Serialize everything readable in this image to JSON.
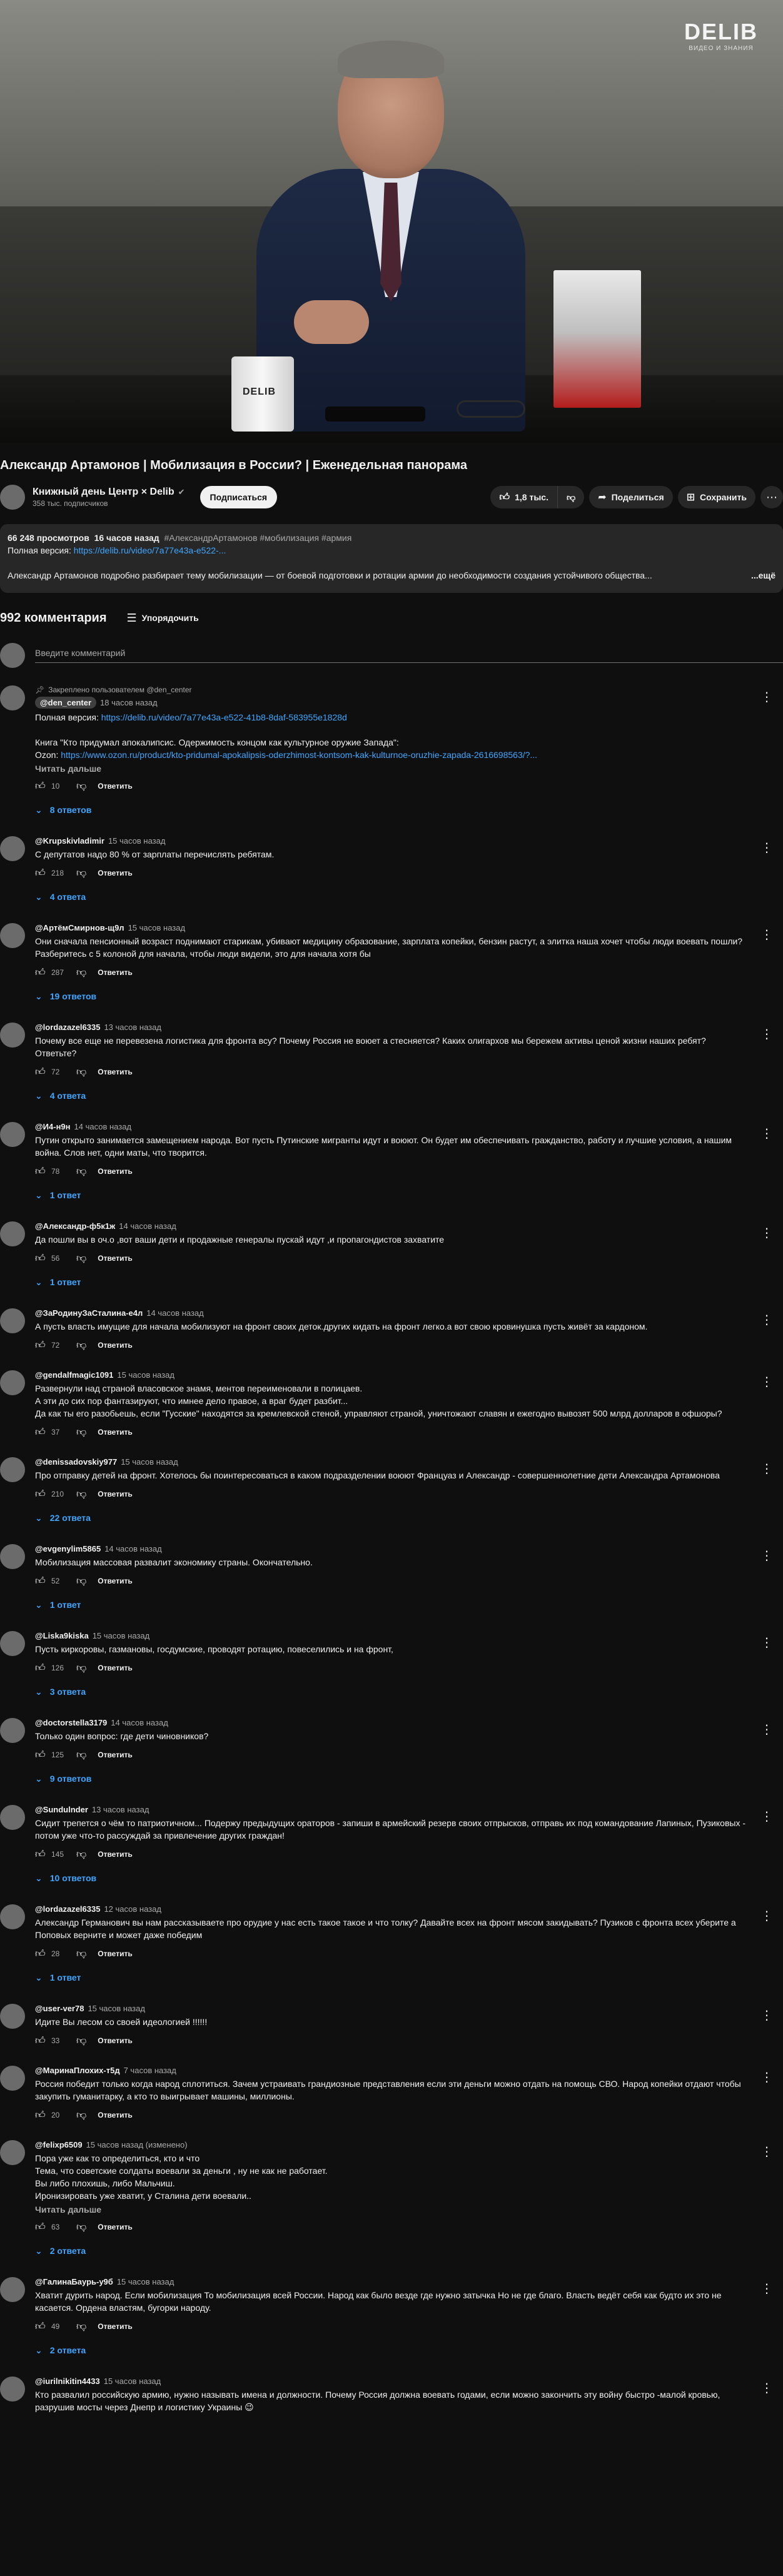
{
  "video": {
    "logo_main": "DELIB",
    "logo_sub": "ВИДЕО И ЗНАНИЯ",
    "mug_text": "DELIB",
    "title": "Александр Артамонов | Мобилизация в России? | Еженедельная панорама"
  },
  "channel": {
    "name": "Книжный день Центр × Delib",
    "verified_icon": "✔",
    "subscribers": "358 тыс. подписчиков",
    "subscribe_label": "Подписаться"
  },
  "actions": {
    "likes": "1,8 тыс.",
    "share_label": "Поделиться",
    "save_label": "Сохранить",
    "more_icon": "⋯"
  },
  "description": {
    "views": "66 248 просмотров",
    "age": "16 часов назад",
    "tags": "#АлександрАртамонов #мобилизация #армия",
    "full_version_label": "Полная версия:",
    "full_version_link": "https://delib.ru/video/7a77e43a-e522-...",
    "text": "Александр Артамонов подробно разбирает тему мобилизации — от боевой подготовки и ротации армии до необходимости создания устойчивого общества...",
    "more": "...ещё"
  },
  "comments_header": {
    "count": "992 комментария",
    "sort_label": "Упорядочить",
    "add_placeholder": "Введите комментарий"
  },
  "comments": [
    {
      "pinned": "Закреплено пользователем @den_center",
      "author": "@den_center",
      "time": "18 часов назад",
      "text_1": "Полная версия:",
      "link_1": "https://delib.ru/video/7a77e43a-e522-41b8-8daf-583955e1828d",
      "text_2": "Книга \"Кто придумал апокалипсис. Одержимость концом как культурное оружие Запада\":",
      "text_3": "Ozon:",
      "link_2": "https://www.ozon.ru/product/kto-pridumal-apokalipsis-oderzhimost-kontsom-kak-kulturnoe-oruzhie-zapada-2616698563/?...",
      "read_more": "Читать дальше",
      "likes": "10",
      "reply": "Ответить",
      "replies": "8 ответов"
    },
    {
      "author": "@Krupskivladimir",
      "time": "15 часов назад",
      "text": "С депутатов надо 80 % от зарплаты перечислять ребятам.",
      "likes": "218",
      "reply": "Ответить",
      "replies": "4 ответа"
    },
    {
      "author": "@АртёмСмирнов-щ9л",
      "time": "15 часов назад",
      "text": "Они сначала пенсионный возраст поднимают старикам, убивают медицину образование, зарплата копейки, бензин растут, а элитка наша хочет чтобы люди воевать пошли? Разберитесь с 5 колоной для  начала, чтобы люди видели, это для начала хотя бы",
      "likes": "287",
      "reply": "Ответить",
      "replies": "19 ответов"
    },
    {
      "author": "@lordazazel6335",
      "time": "13 часов назад",
      "text": "Почему все еще не перевезена логистика для фронта всу? Почему Россия не воюет а стесняется? Каких олигархов мы бережем активы ценой жизни наших ребят? Ответьте?",
      "likes": "72",
      "reply": "Ответить",
      "replies": "4 ответа"
    },
    {
      "author": "@И4-н9н",
      "time": "14 часов назад",
      "text": "Путин открыто занимается замещением народа. Вот пусть Путинские мигранты идут и воюют. Он будет им обеспечивать гражданство, работу и лучшие условия, а нашим война. Слов нет, одни маты, что творится.",
      "likes": "78",
      "reply": "Ответить",
      "replies": "1 ответ"
    },
    {
      "author": "@Александр-ф5к1ж",
      "time": "14 часов назад",
      "text": "Да пошли вы в оч.о ,вот ваши дети и продажные генералы пускай идут ,и пропагондистов захватите",
      "likes": "56",
      "reply": "Ответить",
      "replies": "1 ответ"
    },
    {
      "author": "@ЗаРодинуЗаСталина-е4л",
      "time": "14 часов назад",
      "text": "А пусть власть имущие для начала мобилизуют на фронт своих деток.других кидать на фронт легко.а вот свою кровинушка пусть живёт за кардоном.",
      "likes": "72",
      "reply": "Ответить"
    },
    {
      "author": "@gendalfmagic1091",
      "time": "15 часов назад",
      "text": "Развернули над страной власовское знамя, ментов переименовали в полицаев.\nА эти до сих пор фантазируют, что имнее дело правое, а враг будет разбит...\nДа как ты его разобьешь, если \"Гусские\" находятся за кремлевской стеной, управляют страной, уничтожают славян и ежегодно вывозят 500 млрд долларов в офшоры?",
      "likes": "37",
      "reply": "Ответить"
    },
    {
      "author": "@denissadovskiy977",
      "time": "15 часов назад",
      "text": "Про отправку детей на фронт. Хотелось бы поинтересоваться в каком подразделении воюют Француаз и Александр - совершеннолетние дети Александра Артамонова",
      "likes": "210",
      "reply": "Ответить",
      "replies": "22 ответа"
    },
    {
      "author": "@evgenylim5865",
      "time": "14 часов назад",
      "text": "Мобилизация массовая развалит экономику страны. Окончательно.",
      "likes": "52",
      "reply": "Ответить",
      "replies": "1 ответ"
    },
    {
      "author": "@Liska9kiska",
      "time": "15 часов назад",
      "text": "Пусть киркоровы, газмановы, госдумские, проводят ротацию, повеселились и на фронт,",
      "likes": "126",
      "reply": "Ответить",
      "replies": "3 ответа"
    },
    {
      "author": "@doctorstella3179",
      "time": "14 часов назад",
      "text": "Только один вопрос: где дети чиновников?",
      "likes": "125",
      "reply": "Ответить",
      "replies": "9 ответов"
    },
    {
      "author": "@Sundulnder",
      "time": "13 часов назад",
      "text": "Сидит трепется о чём то патриотичном... Подержу предыдущих ораторов - запиши в армейский резерв своих отпрысков, отправь их под командование Лапиных, Пузиковых - потом уже что-то рассуждай за привлечение других граждан!",
      "likes": "145",
      "reply": "Ответить",
      "replies": "10 ответов"
    },
    {
      "author": "@lordazazel6335",
      "time": "12 часов назад",
      "text": "Александр Германович вы нам рассказываете про орудие у нас есть такое такое и что толку? Давайте всех на фронт мясом закидывать? Пузиков с фронта всех уберите а Поповых верните и может даже победим",
      "likes": "28",
      "reply": "Ответить",
      "replies": "1 ответ"
    },
    {
      "author": "@user-ver78",
      "time": "15 часов назад",
      "text": "Идите Вы лесом со своей идеологией !!!!!!",
      "likes": "33",
      "reply": "Ответить"
    },
    {
      "author": "@МаринаПлохих-т5д",
      "time": "7 часов назад",
      "text": "Россия победит только когда народ сплотиться. Зачем устраивать грандиозные представления если эти деньги можно отдать на помощь СВО. Народ копейки отдают чтобы закупить гуманитарку, а кто то выигрывает машины, миллионы.",
      "likes": "20",
      "reply": "Ответить"
    },
    {
      "author": "@felixp6509",
      "time": "15 часов назад (изменено)",
      "text": "Пора уже как то определиться, кто и что\nТема, что советские солдаты воевали за деньги , ну не как не работает.\nВы либо плохишь, либо Мальчиш.\nИронизировать уже хватит, у Сталина дети воевали..",
      "read_more": "Читать дальше",
      "likes": "63",
      "reply": "Ответить",
      "replies": "2 ответа"
    },
    {
      "author": "@ГалинаБаурь-у9б",
      "time": "15 часов назад",
      "text": "Хватит дурить народ. Если мобилизация То мобилизация всей России. Народ как было везде где нужно затычка Но не где благо. Власть ведёт себя как будто их это не касается. Ордена властям, бугорки народу.",
      "likes": "49",
      "reply": "Ответить",
      "replies": "2 ответа"
    },
    {
      "author": "@iurilnikitin4433",
      "time": "15 часов назад",
      "text": "Кто развалил российскую армию, нужно называть имена и должности. Почему Россия должна воевать годами, если можно закончить эту войну быстро -малой кровью, разрушив мосты через Днепр и  логистику Украины 😉"
    }
  ]
}
